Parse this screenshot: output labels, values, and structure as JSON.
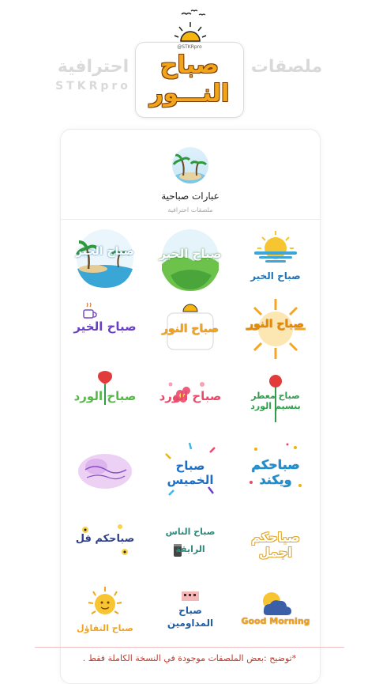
{
  "header": {
    "brand_ar": "ملصقات",
    "brand_ar2": "احترافية",
    "brand_en": "STKRpro",
    "logo_line1": "صباح",
    "logo_line2": "النـــور",
    "logo_tag": "@STKRpro"
  },
  "pack": {
    "title": "عبارات صباحية",
    "subtitle": "ملصقات احترافية"
  },
  "stickers": [
    {
      "id": "sabah-alkhair-sun",
      "text": "صباح الخير"
    },
    {
      "id": "sabah-alkhair-hills",
      "text": "صباح الخير"
    },
    {
      "id": "sabah-alkhair-beach",
      "text": "صباح الخير"
    },
    {
      "id": "sabah-alnoor-sunburst",
      "text": "صباح النور"
    },
    {
      "id": "sabah-alnoor-box",
      "text": "صباح النور"
    },
    {
      "id": "sabah-alkhair-coffee",
      "text": "صباح الخير"
    },
    {
      "id": "sabah-mo3attar",
      "text": "صباح معطر بنسيم الورد"
    },
    {
      "id": "sabah-alward-flowers",
      "text": "صباح الورد"
    },
    {
      "id": "sabah-alward-rose",
      "text": "صباح الورد"
    },
    {
      "id": "sabahkom-wikkend",
      "text": "صباحكم ويكند"
    },
    {
      "id": "sabah-alkhamees",
      "text": "صباح الخميس"
    },
    {
      "id": "sabah-purple",
      "text": ""
    },
    {
      "id": "sabahkom-ajmal",
      "text": "صباحكم اجمل"
    },
    {
      "id": "sabah-alnas-alraiqa",
      "text": "صباح الناس الرايقة"
    },
    {
      "id": "sabahkom-fol",
      "text": "صباحكم فل"
    },
    {
      "id": "good-morning",
      "text": "Good Morning"
    },
    {
      "id": "sabah-almudawimeen",
      "text": "صباح المداومين"
    },
    {
      "id": "sabah-altafaol",
      "text": "صباح التفاؤل"
    }
  ],
  "footer": {
    "note": "*توضيح :بعض الملصقات موجودة في النسخة الكاملة فقط ."
  },
  "colors": {
    "logo_orange": "#f2a41b",
    "logo_outline": "#7a3b00",
    "side_gray": "#d9d9d9",
    "footer_red": "#c0392b"
  }
}
